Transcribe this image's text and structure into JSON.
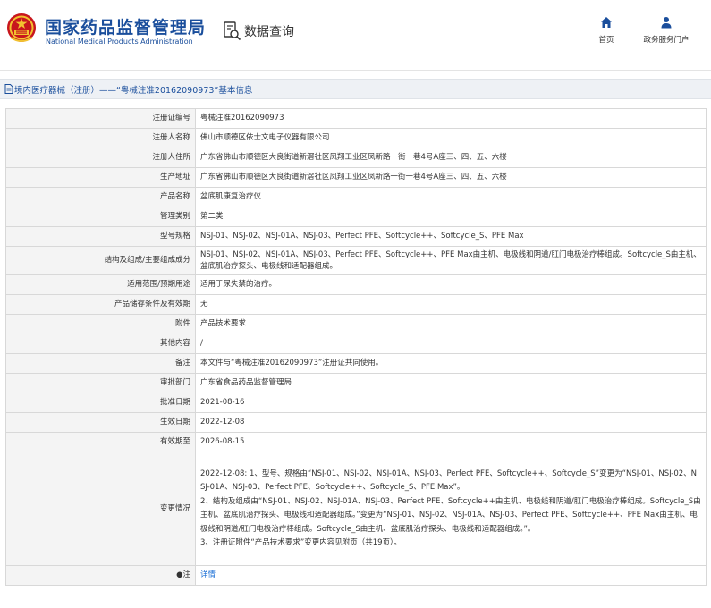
{
  "header": {
    "title_cn": "国家药品监督管理局",
    "title_en": "National Medical Products Administration",
    "query_label": "数据查询",
    "nav": [
      {
        "label": "首页",
        "icon": "home-icon"
      },
      {
        "label": "政务服务门户",
        "icon": "user-icon"
      }
    ]
  },
  "breadcrumb": {
    "text": "境内医疗器械（注册）——“粤械注准20162090973”基本信息",
    "icon": "document-icon"
  },
  "colors": {
    "brand_blue": "#1a4e9c",
    "link_blue": "#1a6fd6",
    "label_bg": "#f4f4f4",
    "crumb_bg": "#eef1f5"
  },
  "rows": [
    {
      "label": "注册证编号",
      "value": "粤械注准20162090973"
    },
    {
      "label": "注册人名称",
      "value": "佛山市顺德区依士文电子仪器有限公司"
    },
    {
      "label": "注册人住所",
      "value": "广东省佛山市顺德区大良街道新滘社区凤翔工业区凤新路一街一巷4号A座三、四、五、六楼"
    },
    {
      "label": "生产地址",
      "value": "广东省佛山市顺德区大良街道新滘社区凤翔工业区凤新路一街一巷4号A座三、四、五、六楼"
    },
    {
      "label": "产品名称",
      "value": "盆底肌康复治疗仪"
    },
    {
      "label": "管理类别",
      "value": "第二类"
    },
    {
      "label": "型号规格",
      "value": "NSJ-01、NSJ-02、NSJ-01A、NSJ-03、Perfect PFE、Softcycle++、Softcycle_S、PFE Max"
    },
    {
      "label": "结构及组成/主要组成成分",
      "value": "NSJ-01、NSJ-02、NSJ-01A、NSJ-03、Perfect PFE、Softcycle++、PFE Max由主机、电极线和阴道/肛门电极治疗棒组成。Softcycle_S由主机、盆底肌治疗探头、电极线和适配器组成。"
    },
    {
      "label": "适用范围/预期用途",
      "value": "适用于尿失禁的治疗。"
    },
    {
      "label": "产品储存条件及有效期",
      "value": "无"
    },
    {
      "label": "附件",
      "value": "产品技术要求"
    },
    {
      "label": "其他内容",
      "value": "/"
    },
    {
      "label": "备注",
      "value": "本文件与“粤械注准20162090973”注册证共同使用。"
    },
    {
      "label": "审批部门",
      "value": "广东省食品药品监督管理局"
    },
    {
      "label": "批准日期",
      "value": "2021-08-16"
    },
    {
      "label": "生效日期",
      "value": "2022-12-08"
    },
    {
      "label": "有效期至",
      "value": "2026-08-15"
    },
    {
      "label": "变更情况",
      "value": "2022-12-08: 1、型号、规格由“NSJ-01、NSJ-02、NSJ-01A、NSJ-03、Perfect PFE、Softcycle++、Softcycle_S”变更为“NSJ-01、NSJ-02、NSJ-01A、NSJ-03、Perfect PFE、Softcycle++、Softcycle_S、PFE Max”。\n2、结构及组成由“NSJ-01、NSJ-02、NSJ-01A、NSJ-03、Perfect PFE、Softcycle++由主机、电极线和阴道/肛门电极治疗棒组成。Softcycle_S由主机、盆底肌治疗探头、电极线和适配器组成。”变更为“NSJ-01、NSJ-02、NSJ-01A、NSJ-03、Perfect PFE、Softcycle++、PFE Max由主机、电极线和阴道/肛门电极治疗棒组成。Softcycle_S由主机、盆底肌治疗探头、电极线和适配器组成。”。\n3、注册证附件“产品技术要求”变更内容见附页（共19页）。"
    },
    {
      "label": "●注",
      "value": "详情",
      "is_link": true
    }
  ]
}
